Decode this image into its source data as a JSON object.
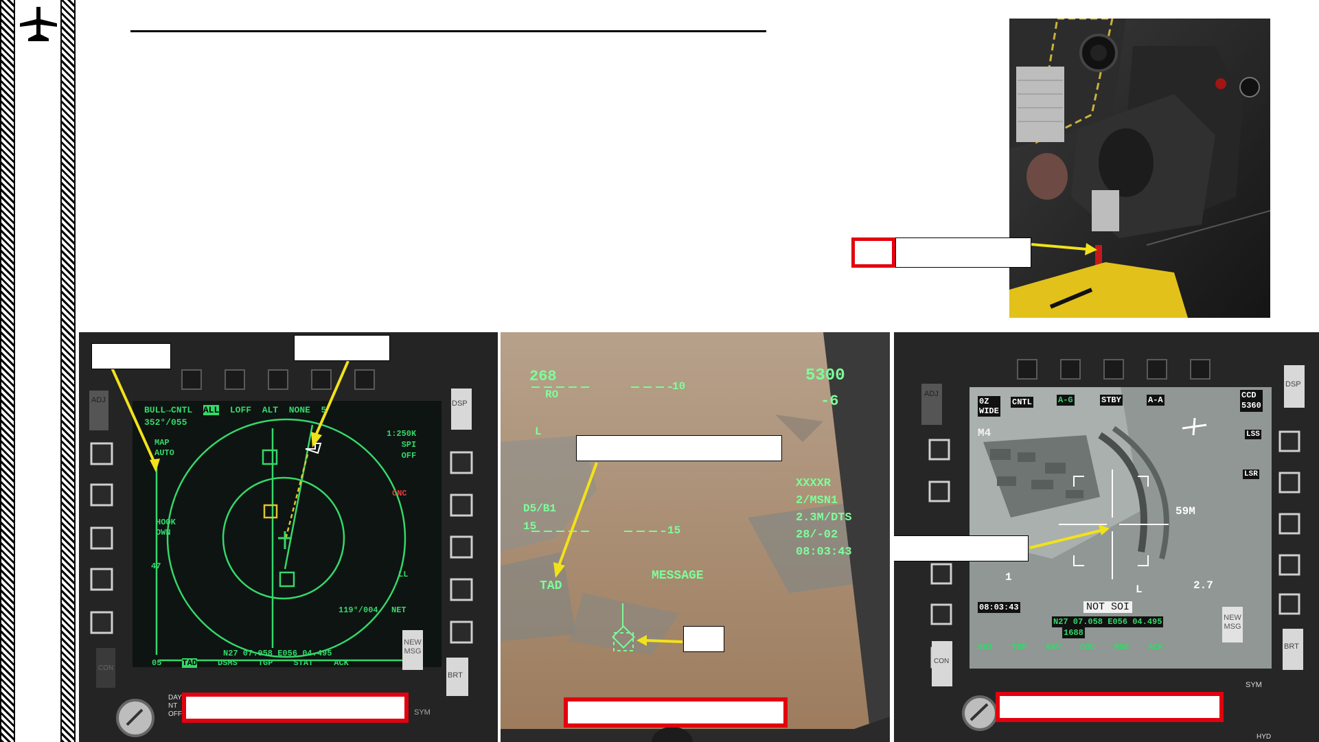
{
  "left_mfcd": {
    "osb_top": [
      "ADJ",
      "DSP"
    ],
    "header": [
      "BULL",
      "CNTL",
      "ALL",
      "LOFF",
      "ALT",
      "NONE",
      "5"
    ],
    "bull": "352°/055",
    "left_labels": [
      "MAP",
      "AUTO",
      "HOOK",
      "OWN"
    ],
    "right_labels": [
      "1:250K",
      "SPI",
      "OFF",
      "CNC",
      "LL",
      "NET"
    ],
    "bearing_range": "119°/004",
    "coords": "N27 07.058 E056 04.495",
    "bottom": [
      "05",
      "TAD",
      "DSMS",
      "TGP",
      "STAT",
      "ACK"
    ],
    "new_msg": [
      "NEW",
      "MSG"
    ],
    "brt": "BRT",
    "con": "CON",
    "sym": "SYM",
    "mode_knob": [
      "DAY",
      "NT",
      "OFF"
    ],
    "count": "47"
  },
  "hud": {
    "heading": "268",
    "ro": "RO",
    "altitude": "5300",
    "vv": "-6",
    "l": "L",
    "ladder_top": "10",
    "ladder_bottom": "15",
    "waypoint": [
      "XXXXR",
      "2/MSN1",
      "2.3M/DTS",
      "28/-02",
      "08:03:43"
    ],
    "steer": [
      "D5/B1",
      "15"
    ],
    "tad": "TAD",
    "message": "MESSAGE"
  },
  "right_mfcd": {
    "header": [
      "0Z",
      "WIDE",
      "CNTL",
      "A-G",
      "STBY",
      "A-A",
      "CCD",
      "5360"
    ],
    "osb": [
      "ADJ",
      "DSP",
      "CON",
      "BRT",
      "SYM",
      "HYD"
    ],
    "m4": "M4",
    "range": "59M",
    "lss": "LSS",
    "lsr": "LSR",
    "num": "2.7",
    "one": "1",
    "l": "L",
    "time": "08:03:43",
    "not_soi": "NOT SOI",
    "coords": "N27 07.058 E056 04.495",
    "elev": "1688",
    "bottom": [
      "053",
      "TGP",
      "NAV",
      "COU",
      "MSG",
      "ACK"
    ],
    "new_msg": [
      "NEW",
      "MSG"
    ]
  }
}
